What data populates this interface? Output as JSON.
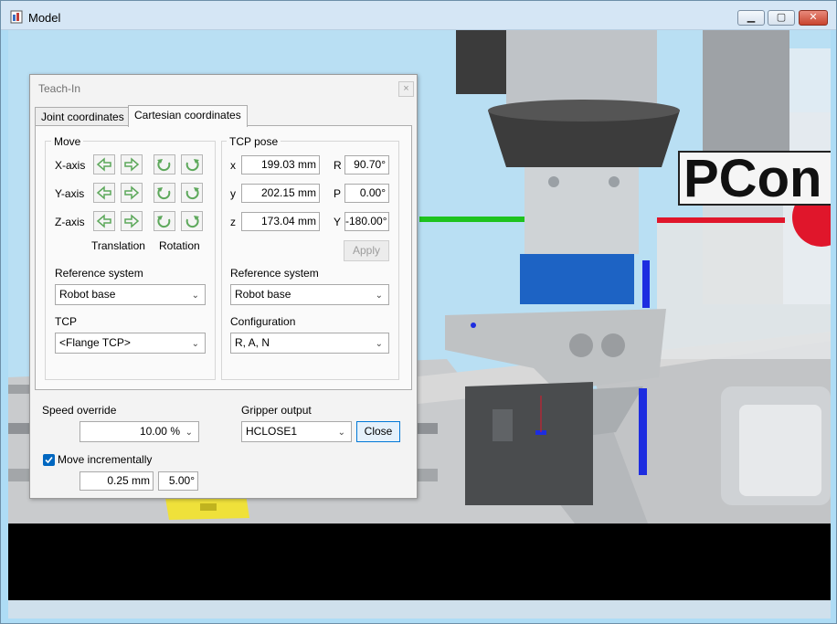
{
  "window": {
    "title": "Model",
    "controls": {
      "minimize": "▁",
      "maximize": "▢",
      "close": "✕"
    }
  },
  "viewport": {
    "sign_text": "PCon",
    "background_color": "#b9dff3"
  },
  "dialog": {
    "title": "Teach-In",
    "close_glyph": "×",
    "tabs": [
      {
        "label": "Joint coordinates",
        "active": false
      },
      {
        "label": "Cartesian coordinates",
        "active": true
      }
    ],
    "move": {
      "group_label": "Move",
      "axes": [
        "X-axis",
        "Y-axis",
        "Z-axis"
      ],
      "translation_label": "Translation",
      "rotation_label": "Rotation",
      "reference_system_label": "Reference system",
      "reference_system_value": "Robot base",
      "tcp_label": "TCP",
      "tcp_value": "<Flange TCP>"
    },
    "tcp_pose": {
      "group_label": "TCP pose",
      "x_label": "x",
      "x_value": "199.03 mm",
      "y_label": "y",
      "y_value": "202.15 mm",
      "z_label": "z",
      "z_value": "173.04 mm",
      "r_label": "R",
      "r_value": "90.70°",
      "p_label": "P",
      "p_value": "0.00°",
      "yaw_label": "Y",
      "yaw_value": "-180.00°",
      "apply_label": "Apply",
      "reference_system_label": "Reference system",
      "reference_system_value": "Robot base",
      "configuration_label": "Configuration",
      "configuration_value": "R, A, N"
    },
    "speed_override_label": "Speed override",
    "speed_override_value": "10.00 %",
    "gripper_output_label": "Gripper output",
    "gripper_output_value": "HCLOSE1",
    "close_label": "Close",
    "move_incrementally_label": "Move incrementally",
    "move_incrementally_checked": true,
    "increment_distance": "0.25 mm",
    "increment_angle": "5.00°"
  },
  "colors": {
    "arrow_green": "#5da85b",
    "checkbox_blue": "#0067c0",
    "robot_blue": "#1d63c4",
    "axis_red": "#e0162b",
    "axis_green": "#1ec31e"
  }
}
